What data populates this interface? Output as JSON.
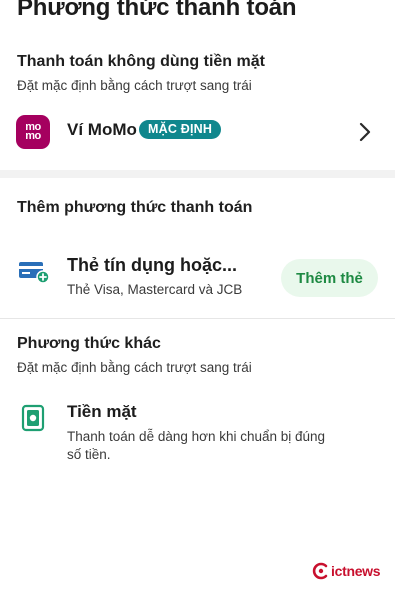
{
  "header": {
    "title": "Phương thức thanh toán"
  },
  "cashless": {
    "title": "Thanh toán không dùng tiền mặt",
    "hint": "Đặt mặc định bằng cách trượt sang trái",
    "wallet": {
      "logo_top": "mo",
      "logo_bottom": "mo",
      "name": "Ví MoMo",
      "badge": "MẶC ĐỊNH",
      "icon": "chevron-right-icon"
    }
  },
  "add_method": {
    "title": "Thêm phương thức thanh toán",
    "card": {
      "icon": "credit-card-add-icon",
      "name": "Thẻ tín dụng hoặc...",
      "subtitle": "Thẻ Visa, Mastercard và JCB",
      "button": "Thêm thẻ"
    }
  },
  "other": {
    "title": "Phương thức khác",
    "hint": "Đặt mặc định bằng cách trượt sang trái",
    "cash": {
      "icon": "cash-icon",
      "name": "Tiền mặt",
      "description": "Thanh toán dễ dàng hơn khi chuẩn bị đúng số tiền."
    }
  },
  "watermark": {
    "text": "ictnews"
  },
  "colors": {
    "momo_brand": "#a5005f",
    "badge": "#10878d",
    "add_button_bg": "#e9f8ec",
    "add_button_text": "#1e8a43",
    "icon_blue": "#2a6fb8",
    "icon_green": "#1e9f72",
    "watermark": "#c8102e"
  }
}
